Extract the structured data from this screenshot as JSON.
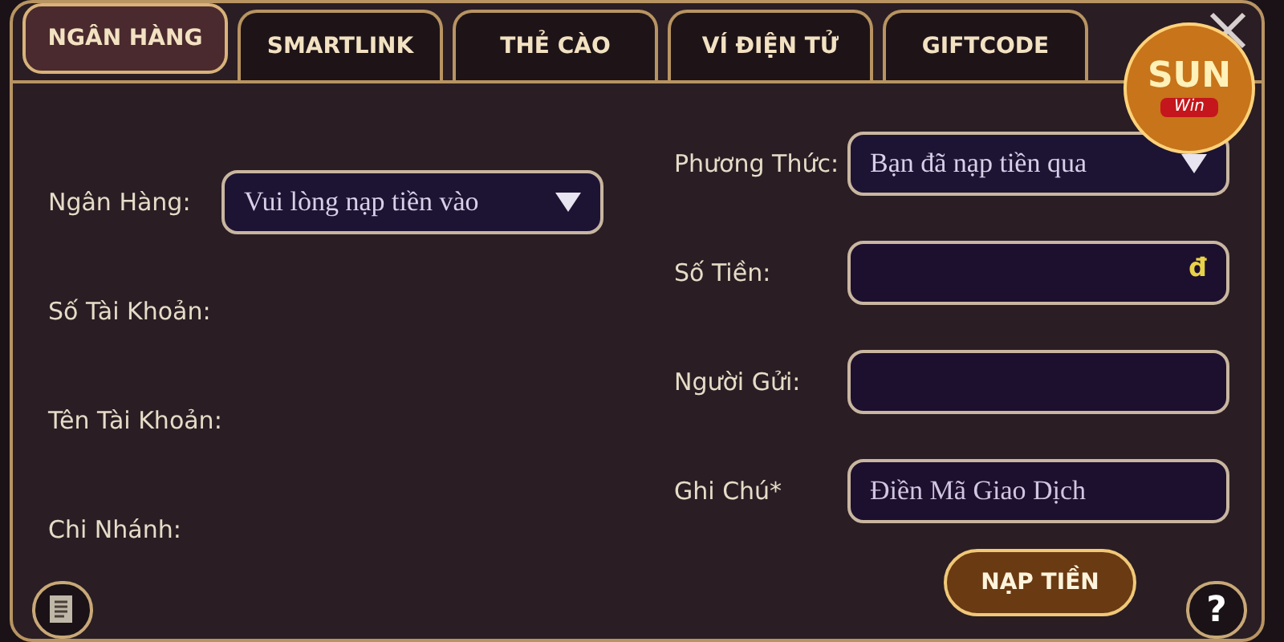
{
  "tabs": [
    {
      "label": "NGÂN HÀNG",
      "selected": true
    },
    {
      "label": "SMARTLINK",
      "selected": false
    },
    {
      "label": "THẺ CÀO",
      "selected": false
    },
    {
      "label": "VÍ ĐIỆN TỬ",
      "selected": false
    },
    {
      "label": "GIFTCODE",
      "selected": false
    }
  ],
  "logo": {
    "top": "SUN",
    "bottom": "Win"
  },
  "left_fields": [
    {
      "kind": "select",
      "label": "Ngân Hàng:",
      "value": "Vui lòng nạp tiền vào"
    },
    {
      "kind": "text",
      "label": "Số Tài Khoản:"
    },
    {
      "kind": "text",
      "label": "Tên Tài Khoản:"
    },
    {
      "kind": "text",
      "label": "Chi Nhánh:"
    }
  ],
  "right_fields": [
    {
      "kind": "select",
      "label": "Phương Thức:",
      "value": "Bạn đã nạp tiền qua"
    },
    {
      "kind": "input",
      "label": "Số Tiền:",
      "suffix": "đ"
    },
    {
      "kind": "input",
      "label": "Người Gửi:"
    },
    {
      "kind": "input",
      "label": "Ghi Chú*",
      "placeholder": "Điền Mã Giao Dịch"
    }
  ],
  "submit_button": "NẠP TIỀN",
  "help_button": "?"
}
